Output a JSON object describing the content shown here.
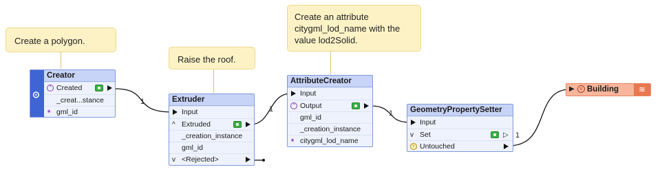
{
  "annotations": {
    "creator_note": "Create a polygon.",
    "extruder_note": "Raise the roof.",
    "attr_note_line1": "Create an attribute",
    "attr_note_line2": "citygml_lod_name with the",
    "attr_note_line3": "value lod2Solid."
  },
  "creator": {
    "title": "Creator",
    "port_created": "Created",
    "attr_creation": "_creat...stance",
    "attr_gml_id": "gml_id"
  },
  "extruder": {
    "title": "Extruder",
    "port_input": "Input",
    "port_extruded": "Extruded",
    "attr_creation": "_creation_instance",
    "attr_gml_id": "gml_id",
    "port_rejected": "<Rejected>"
  },
  "attribute_creator": {
    "title": "AttributeCreator",
    "port_input": "Input",
    "port_output": "Output",
    "attr_gml_id": "gml_id",
    "attr_creation": "_creation_instance",
    "attr_lod_name": "citygml_lod_name"
  },
  "geometry_setter": {
    "title": "GeometryPropertySetter",
    "port_input": "Input",
    "port_set": "Set",
    "port_untouched": "Untouched"
  },
  "writer": {
    "title": "Building"
  },
  "connection_counts": {
    "c1": "1",
    "c2": "1",
    "c3": "1",
    "c4": "1"
  },
  "colors": {
    "transformer_fill": "#eef2fc",
    "transformer_border": "#7f98d8",
    "reader_band": "#3f64d4",
    "writer_fill": "#f7b69c",
    "note_fill": "#fdf2c6"
  }
}
